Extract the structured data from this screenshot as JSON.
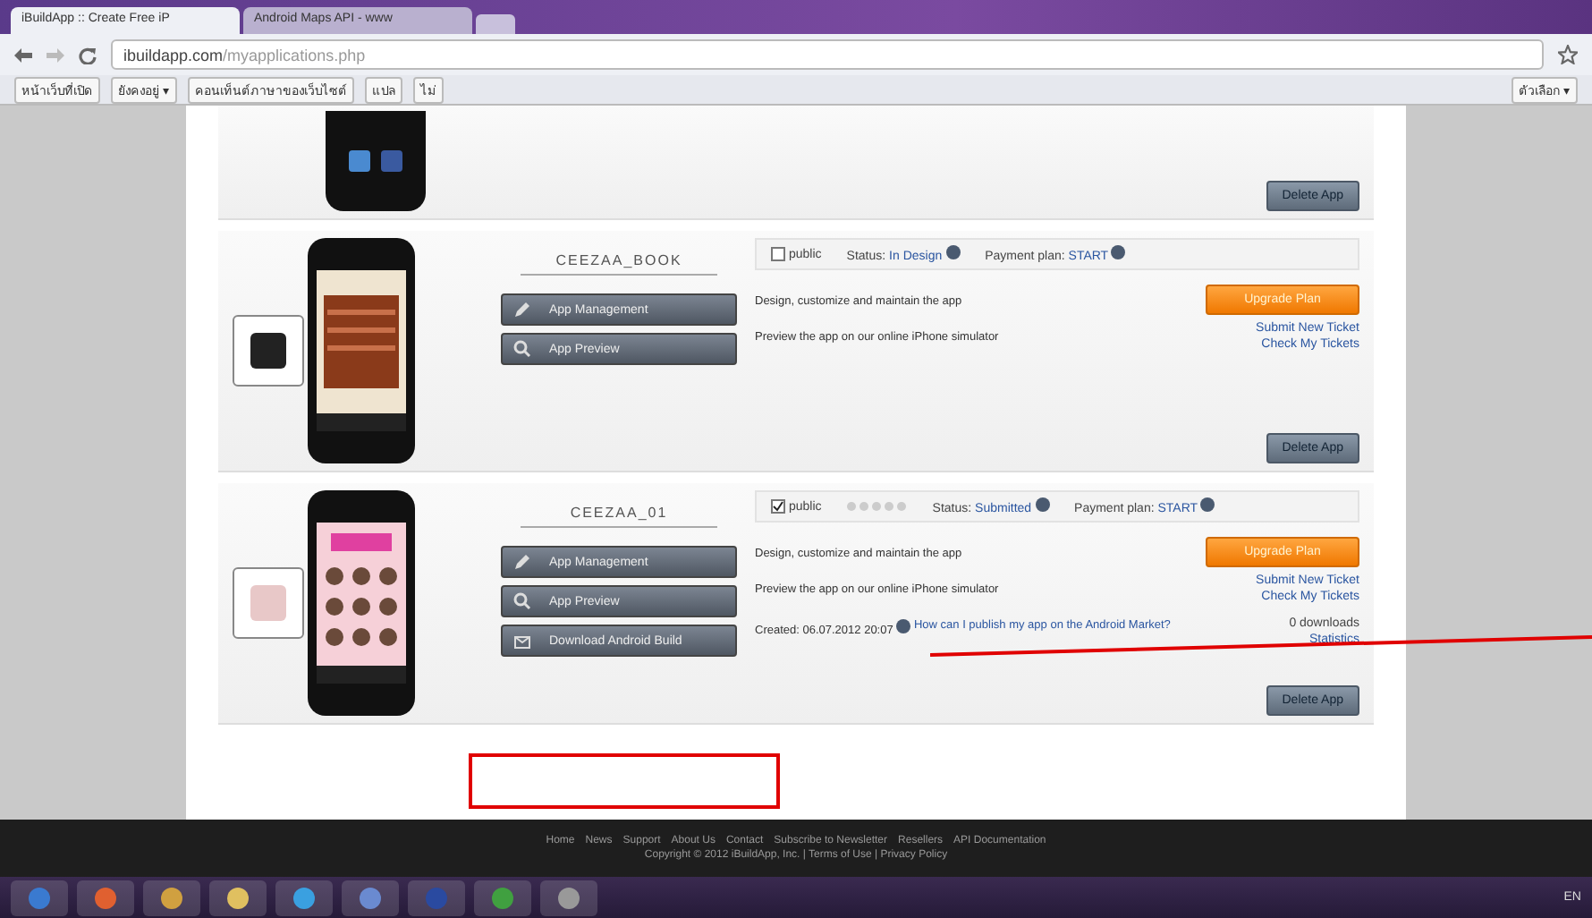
{
  "browser": {
    "tabs": [
      {
        "label": "iBuildApp :: Create Free iP",
        "selected": true
      },
      {
        "label": "Android Maps API - www",
        "selected": false
      }
    ],
    "url_host": "ibuildapp.com",
    "url_path": "/myapplications.php",
    "bookmarks": [
      {
        "label": "หน้าเว็บที่เปิด"
      },
      {
        "label": "ยังคงอยู่ ▾"
      },
      {
        "label": "คอนเท็นต์ภาษาของเว็บไซต์"
      },
      {
        "label": "แปล"
      },
      {
        "label": "ไม่"
      }
    ],
    "options": "ตัวเลือก ▾"
  },
  "top_card": {
    "delete": "Delete App"
  },
  "apps": [
    {
      "name": "CEEZAA_BOOK",
      "public": false,
      "public_label": "public",
      "show_stars": false,
      "status_label": "Status:",
      "status": "In Design",
      "plan_label": "Payment plan:",
      "plan": "START",
      "actions": [
        {
          "kind": "edit",
          "label": "App Management",
          "text": "Design, customize and maintain the app"
        },
        {
          "kind": "preview",
          "label": "App Preview",
          "text": "Preview the app on our online iPhone simulator"
        }
      ],
      "primary": "Upgrade Plan",
      "links": [
        "Submit New Ticket",
        "Check My Tickets"
      ],
      "delete": "Delete App"
    },
    {
      "name": "CEEZAA_01",
      "public": true,
      "public_label": "public",
      "show_stars": true,
      "status_label": "Status:",
      "status": "Submitted",
      "plan_label": "Payment plan:",
      "plan": "START",
      "actions": [
        {
          "kind": "edit",
          "label": "App Management",
          "text": "Design, customize and maintain the app"
        },
        {
          "kind": "preview",
          "label": "App Preview",
          "text": "Preview the app on our online iPhone simulator"
        },
        {
          "kind": "download",
          "label": "Download Android Build"
        }
      ],
      "created": "Created: 06.07.2012 20:07",
      "publish_link": "How can I publish my app on the Android Market?",
      "primary": "Upgrade Plan",
      "links": [
        "Submit New Ticket",
        "Check My Tickets"
      ],
      "downloads": "0 downloads",
      "stats": "Statistics",
      "delete": "Delete App"
    }
  ],
  "footer": {
    "links": [
      "Home",
      "News",
      "Support",
      "About Us",
      "Contact",
      "Subscribe to Newsletter",
      "Resellers",
      "API Documentation"
    ],
    "copyright": "Copyright © 2012 iBuildApp, Inc. | Terms of Use | Privacy Policy"
  },
  "taskbar": {
    "tray": "EN"
  }
}
